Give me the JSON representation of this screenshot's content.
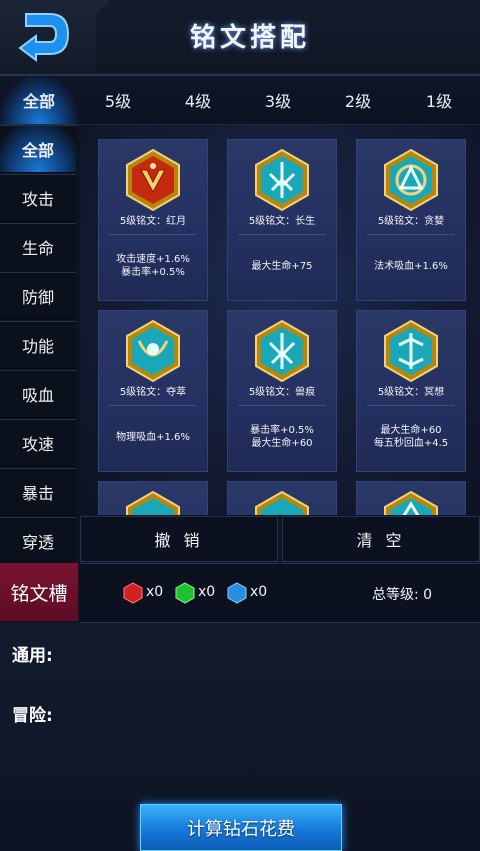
{
  "header": {
    "title": "铭文搭配"
  },
  "level_tabs": [
    {
      "label": "全部",
      "active": true
    },
    {
      "label": "5级",
      "active": false
    },
    {
      "label": "4级",
      "active": false
    },
    {
      "label": "3级",
      "active": false
    },
    {
      "label": "2级",
      "active": false
    },
    {
      "label": "1级",
      "active": false
    }
  ],
  "categories": [
    {
      "label": "全部",
      "active": true
    },
    {
      "label": "攻击",
      "active": false
    },
    {
      "label": "生命",
      "active": false
    },
    {
      "label": "防御",
      "active": false
    },
    {
      "label": "功能",
      "active": false
    },
    {
      "label": "吸血",
      "active": false
    },
    {
      "label": "攻速",
      "active": false
    },
    {
      "label": "暴击",
      "active": false
    },
    {
      "label": "穿透",
      "active": false
    }
  ],
  "runes": [
    {
      "name": "5级铭文：红月",
      "effects": [
        "攻击速度+1.6%",
        "暴击率+0.5%"
      ],
      "color": "red",
      "icon": "red-moon-rune-icon"
    },
    {
      "name": "5级铭文：长生",
      "effects": [
        "最大生命+75"
      ],
      "color": "cyan",
      "icon": "longevity-rune-icon"
    },
    {
      "name": "5级铭文：贪婪",
      "effects": [
        "法术吸血+1.6%"
      ],
      "color": "cyan",
      "icon": "greed-rune-icon"
    },
    {
      "name": "5级铭文：夺萃",
      "effects": [
        "物理吸血+1.6%"
      ],
      "color": "cyan",
      "icon": "extract-rune-icon"
    },
    {
      "name": "5级铭文：兽痕",
      "effects": [
        "暴击率+0.5%",
        "最大生命+60"
      ],
      "color": "cyan",
      "icon": "beast-mark-rune-icon"
    },
    {
      "name": "5级铭文：冥想",
      "effects": [
        "最大生命+60",
        "每五秒回血+4.5"
      ],
      "color": "cyan",
      "icon": "meditation-rune-icon"
    }
  ],
  "actions": {
    "undo": "撤 销",
    "clear": "清 空"
  },
  "slots": {
    "label": "铭文槽",
    "gems": [
      {
        "color": "#d42020",
        "count": "x0",
        "icon": "red-gem-icon"
      },
      {
        "color": "#20c030",
        "count": "x0",
        "icon": "green-gem-icon"
      },
      {
        "color": "#2a8ce0",
        "count": "x0",
        "icon": "blue-gem-icon"
      }
    ],
    "total_level": "总等级: 0"
  },
  "info": {
    "general": "通用:",
    "adventure": "冒险:"
  },
  "calc_button": "计算钻石花费",
  "colors": {
    "accent": "#1b7ad8",
    "slot_red": "#7a1430",
    "card_bg": "#2a3868"
  }
}
